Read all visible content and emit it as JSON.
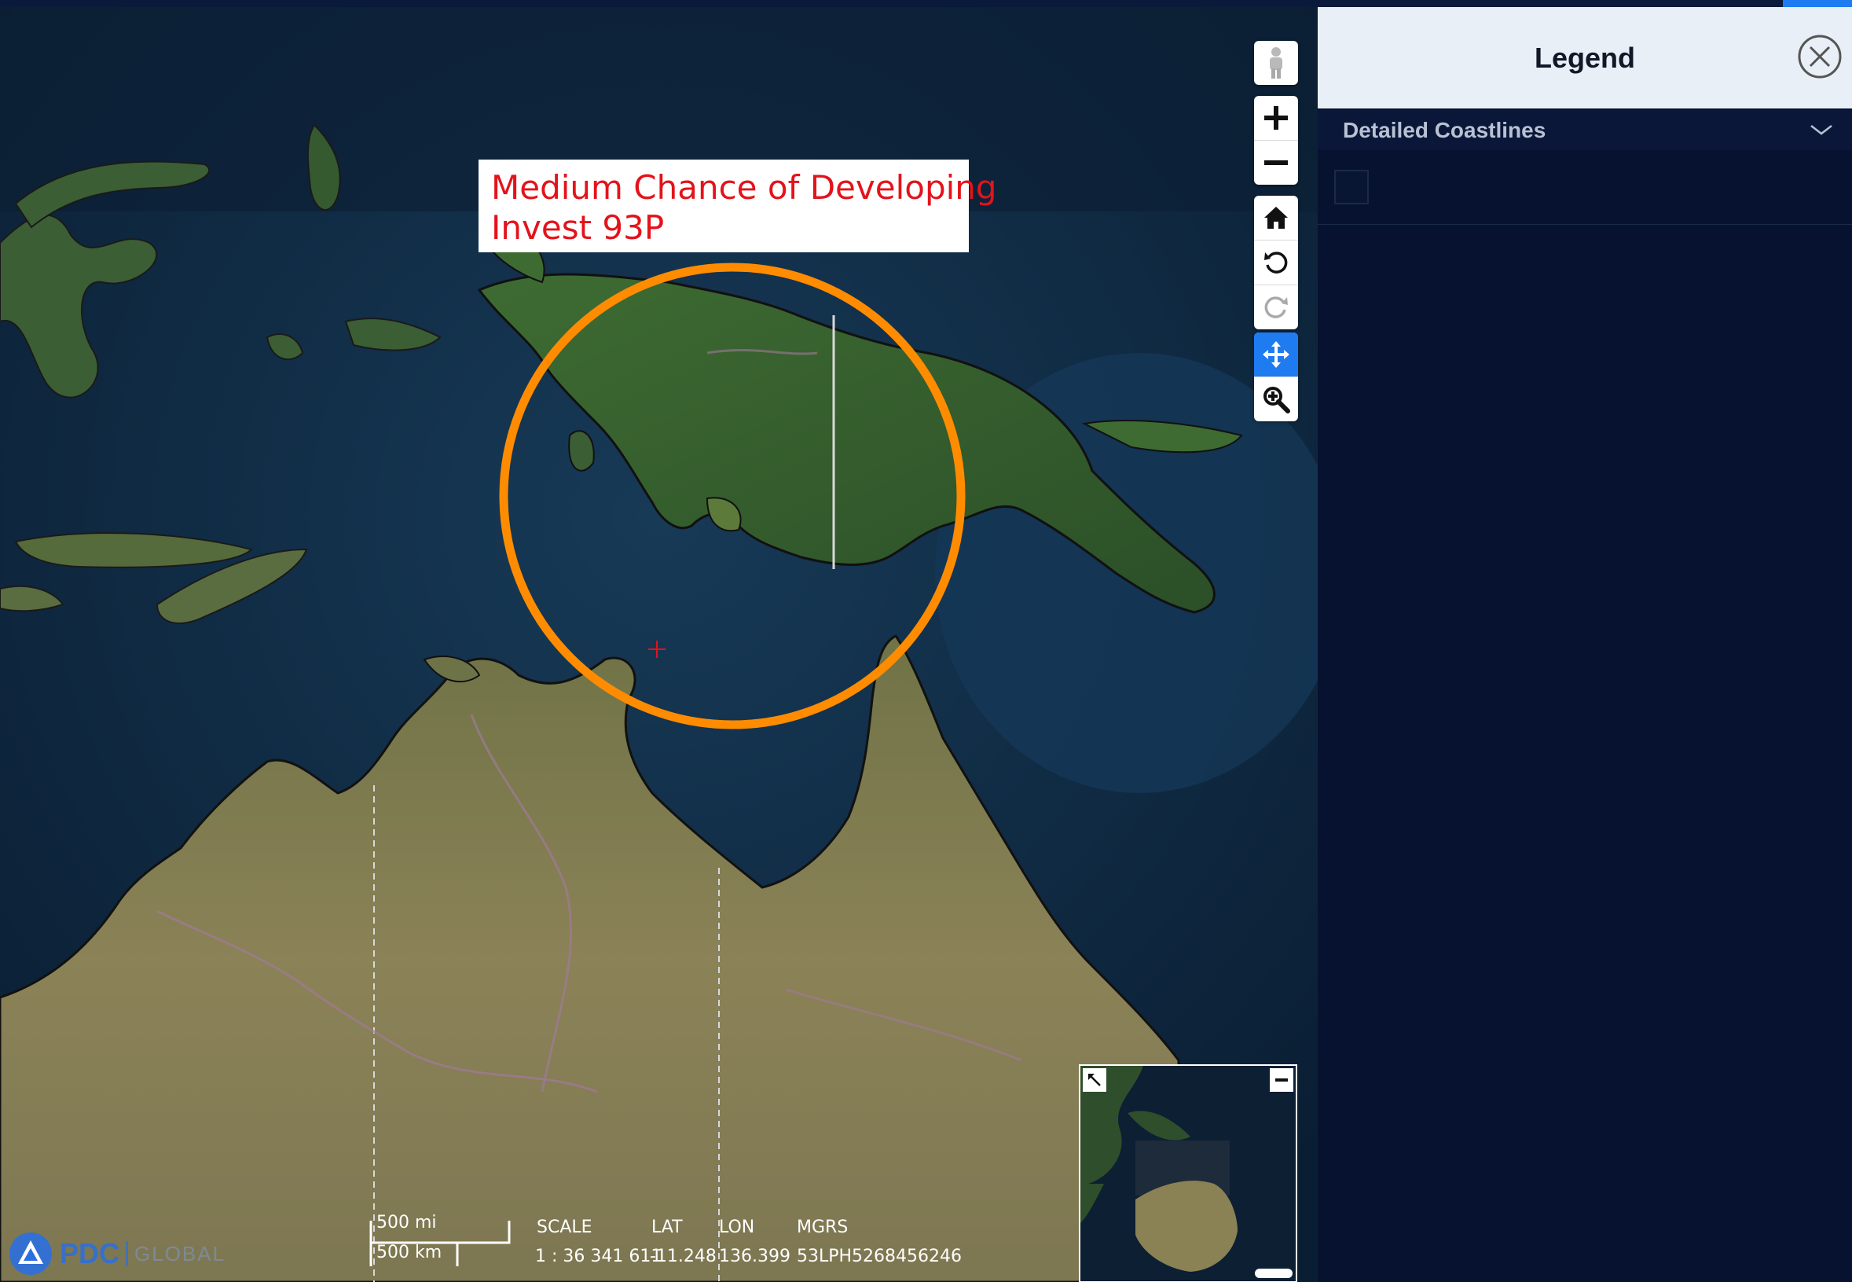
{
  "callout": {
    "line1": "Medium Chance of Developing",
    "line2": "Invest 93P"
  },
  "scale": {
    "imperial": "500 mi",
    "metric": "500 km"
  },
  "readout": {
    "scale_label": "SCALE",
    "scale_value": "1 : 36 341 611",
    "lat_label": "LAT",
    "lat_value": "-11.248",
    "lon_label": "LON",
    "lon_value": "136.399",
    "mgrs_label": "MGRS",
    "mgrs_value": "53LPH5268456246"
  },
  "branding": {
    "name": "PDC",
    "suffix": "GLOBAL"
  },
  "legend": {
    "title": "Legend",
    "section_label": "Detailed Coastlines"
  },
  "controls": [
    "pegman-icon",
    "zoom-in-icon",
    "zoom-out-icon",
    "home-icon",
    "rotate-left-icon",
    "rotate-right-icon",
    "pan-icon",
    "zoom-box-icon"
  ],
  "colors": {
    "circle": "#ff8c00",
    "callout_text": "#e3131b",
    "accent": "#1e7bf0",
    "ocean": "#0e2740",
    "land_green": "#2f5a2c",
    "land_desert": "#8a8155"
  }
}
